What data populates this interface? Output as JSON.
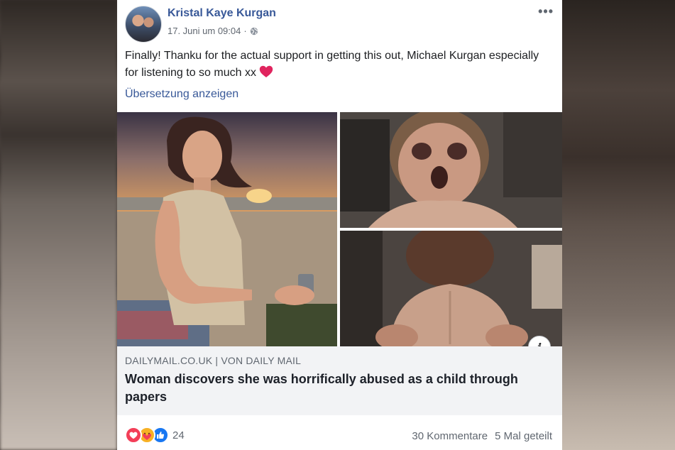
{
  "post": {
    "author": "Kristal Kaye Kurgan",
    "timestamp": "17. Juni um 09:04",
    "separator": "·",
    "privacy_icon": "globe-icon",
    "more_icon": "•••",
    "text": "Finally! Thanku for the actual support in getting this out, Michael Kurgan especially for listening to so much xx",
    "translate_label": "Übersetzung anzeigen"
  },
  "link_preview": {
    "source": "DAILYMAIL.CO.UK | VON DAILY MAIL",
    "headline": "Woman discovers she was horrifically abused as a child through papers",
    "info_label": "i"
  },
  "footer": {
    "reactions": [
      "love-icon",
      "care-icon",
      "like-icon"
    ],
    "reaction_count": "24",
    "comments": "30 Kommentare",
    "shares": "5 Mal geteilt"
  },
  "colors": {
    "link_blue": "#385898",
    "secondary_text": "#606770",
    "love_red": "#f33e58",
    "like_blue": "#1877f2",
    "care_yellow": "#f7b125"
  }
}
